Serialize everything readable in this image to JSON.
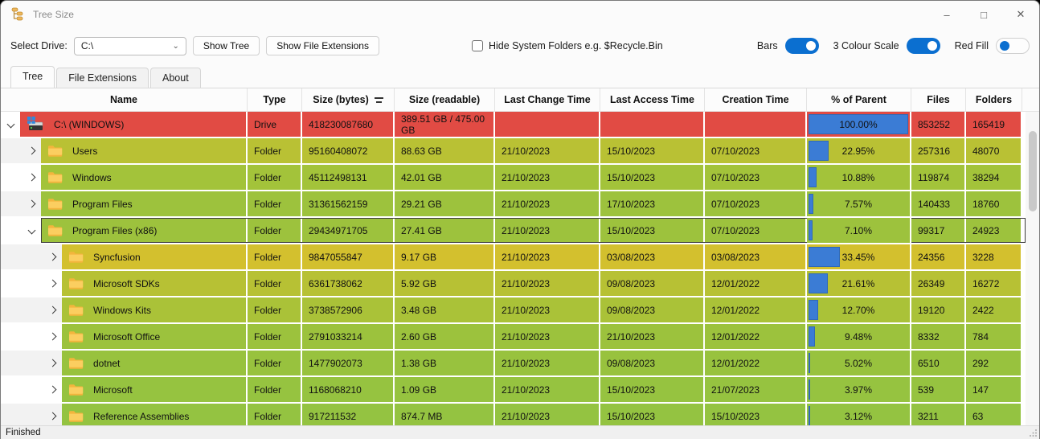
{
  "window": {
    "title": "Tree Size",
    "status": "Finished"
  },
  "titlebar_icons": {
    "app": "tree-size-icon",
    "minimize": "–",
    "maximize": "□",
    "close": "✕"
  },
  "toolbar": {
    "select_drive_label": "Select Drive:",
    "drive_value": "C:\\",
    "show_tree_label": "Show Tree",
    "show_file_extensions_label": "Show File Extensions",
    "hide_system_label": "Hide System Folders e.g. $Recycle.Bin",
    "hide_system_checked": false,
    "toggles": [
      {
        "label": "Bars",
        "on": true
      },
      {
        "label": "3 Colour Scale",
        "on": true
      },
      {
        "label": "Red Fill",
        "on": false
      }
    ]
  },
  "tabs": [
    {
      "label": "Tree",
      "active": true
    },
    {
      "label": "File Extensions",
      "active": false
    },
    {
      "label": "About",
      "active": false
    }
  ],
  "colors": {
    "accent_blue": "#0b6fd0",
    "pct_bar_blue": "#3b7cd5",
    "drive_red": "#e14b44"
  },
  "table": {
    "columns": [
      "Name",
      "Type",
      "Size (bytes)",
      "Size (readable)",
      "Last Change Time",
      "Last Access Time",
      "Creation Time",
      "% of Parent",
      "Files",
      "Folders"
    ],
    "sorted_column": "Size (bytes)",
    "rows": [
      {
        "name": "C:\\ (WINDOWS)",
        "icon": "drive",
        "level": 0,
        "expanded": true,
        "type": "Drive",
        "size_bytes": "418230087680",
        "size_readable": "389.51 GB / 475.00 GB",
        "last_change": "",
        "last_access": "",
        "creation": "",
        "pct": "100.00%",
        "pct_value": 100.0,
        "files": "853252",
        "folders": "165419",
        "color": "#e14b44",
        "focused": false
      },
      {
        "name": "Users",
        "icon": "folder",
        "level": 1,
        "expanded": false,
        "type": "Folder",
        "size_bytes": "95160408072",
        "size_readable": "88.63 GB",
        "last_change": "21/10/2023",
        "last_access": "15/10/2023",
        "creation": "07/10/2023",
        "pct": "22.95%",
        "pct_value": 22.95,
        "files": "257316",
        "folders": "48070",
        "color": "#b9c134",
        "focused": false
      },
      {
        "name": "Windows",
        "icon": "folder",
        "level": 1,
        "expanded": false,
        "type": "Folder",
        "size_bytes": "45112498131",
        "size_readable": "42.01 GB",
        "last_change": "21/10/2023",
        "last_access": "15/10/2023",
        "creation": "07/10/2023",
        "pct": "10.88%",
        "pct_value": 10.88,
        "files": "119874",
        "folders": "38294",
        "color": "#a3c33a",
        "focused": false
      },
      {
        "name": "Program Files",
        "icon": "folder",
        "level": 1,
        "expanded": false,
        "type": "Folder",
        "size_bytes": "31361562159",
        "size_readable": "29.21 GB",
        "last_change": "21/10/2023",
        "last_access": "17/10/2023",
        "creation": "07/10/2023",
        "pct": "7.57%",
        "pct_value": 7.57,
        "files": "140433",
        "folders": "18760",
        "color": "#9dc23d",
        "focused": false
      },
      {
        "name": "Program Files (x86)",
        "icon": "folder",
        "level": 1,
        "expanded": true,
        "type": "Folder",
        "size_bytes": "29434971705",
        "size_readable": "27.41 GB",
        "last_change": "21/10/2023",
        "last_access": "15/10/2023",
        "creation": "07/10/2023",
        "pct": "7.10%",
        "pct_value": 7.1,
        "files": "99317",
        "folders": "24923",
        "color": "#9dc23d",
        "focused": true
      },
      {
        "name": "Syncfusion",
        "icon": "folder",
        "level": 2,
        "expanded": false,
        "type": "Folder",
        "size_bytes": "9847055847",
        "size_readable": "9.17 GB",
        "last_change": "21/10/2023",
        "last_access": "03/08/2023",
        "creation": "03/08/2023",
        "pct": "33.45%",
        "pct_value": 33.45,
        "files": "24356",
        "folders": "3228",
        "color": "#d3c02e",
        "focused": false
      },
      {
        "name": "Microsoft SDKs",
        "icon": "folder",
        "level": 2,
        "expanded": false,
        "type": "Folder",
        "size_bytes": "6361738062",
        "size_readable": "5.92 GB",
        "last_change": "21/10/2023",
        "last_access": "09/08/2023",
        "creation": "12/01/2022",
        "pct": "21.61%",
        "pct_value": 21.61,
        "files": "26349",
        "folders": "16272",
        "color": "#b7c134",
        "focused": false
      },
      {
        "name": "Windows Kits",
        "icon": "folder",
        "level": 2,
        "expanded": false,
        "type": "Folder",
        "size_bytes": "3738572906",
        "size_readable": "3.48 GB",
        "last_change": "21/10/2023",
        "last_access": "09/08/2023",
        "creation": "12/01/2022",
        "pct": "12.70%",
        "pct_value": 12.7,
        "files": "19120",
        "folders": "2422",
        "color": "#aac238",
        "focused": false
      },
      {
        "name": "Microsoft Office",
        "icon": "folder",
        "level": 2,
        "expanded": false,
        "type": "Folder",
        "size_bytes": "2791033214",
        "size_readable": "2.60 GB",
        "last_change": "21/10/2023",
        "last_access": "21/10/2023",
        "creation": "12/01/2022",
        "pct": "9.48%",
        "pct_value": 9.48,
        "files": "8332",
        "folders": "784",
        "color": "#9cc23d",
        "focused": false
      },
      {
        "name": "dotnet",
        "icon": "folder",
        "level": 2,
        "expanded": false,
        "type": "Folder",
        "size_bytes": "1477902073",
        "size_readable": "1.38 GB",
        "last_change": "21/10/2023",
        "last_access": "09/08/2023",
        "creation": "12/01/2022",
        "pct": "5.02%",
        "pct_value": 5.02,
        "files": "6510",
        "folders": "292",
        "color": "#98c23e",
        "focused": false
      },
      {
        "name": "Microsoft",
        "icon": "folder",
        "level": 2,
        "expanded": false,
        "type": "Folder",
        "size_bytes": "1168068210",
        "size_readable": "1.09 GB",
        "last_change": "21/10/2023",
        "last_access": "15/10/2023",
        "creation": "21/07/2023",
        "pct": "3.97%",
        "pct_value": 3.97,
        "files": "539",
        "folders": "147",
        "color": "#96c340",
        "focused": false
      },
      {
        "name": "Reference Assemblies",
        "icon": "folder",
        "level": 2,
        "expanded": false,
        "type": "Folder",
        "size_bytes": "917211532",
        "size_readable": "874.7 MB",
        "last_change": "21/10/2023",
        "last_access": "15/10/2023",
        "creation": "15/10/2023",
        "pct": "3.12%",
        "pct_value": 3.12,
        "files": "3211",
        "folders": "63",
        "color": "#94c341",
        "focused": false
      }
    ]
  }
}
